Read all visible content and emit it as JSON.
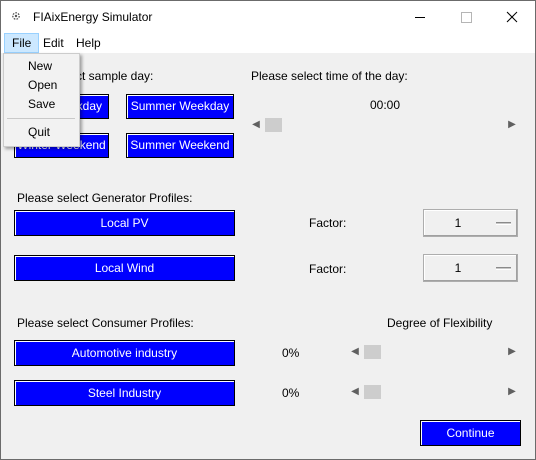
{
  "window": {
    "title": "FIAixEnergy Simulator"
  },
  "menu": {
    "file": "File",
    "edit": "Edit",
    "help": "Help"
  },
  "file_menu": {
    "new": "New",
    "open": "Open",
    "save": "Save",
    "quit": "Quit"
  },
  "sample_day": {
    "label_visible": "ct sample day:",
    "buttons": {
      "winter_weekday_visible": "ekday",
      "summer_weekday": "Summer Weekday",
      "winter_weekend": "Winter Weekend",
      "summer_weekend": "Summer Weekend"
    }
  },
  "time_of_day": {
    "label": "Please select time of the day:",
    "value": "00:00",
    "slider_position": 0
  },
  "generators": {
    "label": "Please select Generator Profiles:",
    "items": [
      {
        "name": "Local PV",
        "factor_label": "Factor:",
        "factor_value": "1"
      },
      {
        "name": "Local Wind",
        "factor_label": "Factor:",
        "factor_value": "1"
      }
    ]
  },
  "consumers": {
    "label": "Please select Consumer Profiles:",
    "flex_header": "Degree of Flexibility",
    "items": [
      {
        "name": "Automotive industry",
        "flex_value": "0%",
        "slider_position": 0
      },
      {
        "name": "Steel Industry",
        "flex_value": "0%",
        "slider_position": 0
      }
    ]
  },
  "continue_label": "Continue",
  "icons": {
    "app": "gear-icon",
    "minimize": "minimize-icon",
    "maximize": "maximize-icon",
    "close": "close-icon"
  }
}
